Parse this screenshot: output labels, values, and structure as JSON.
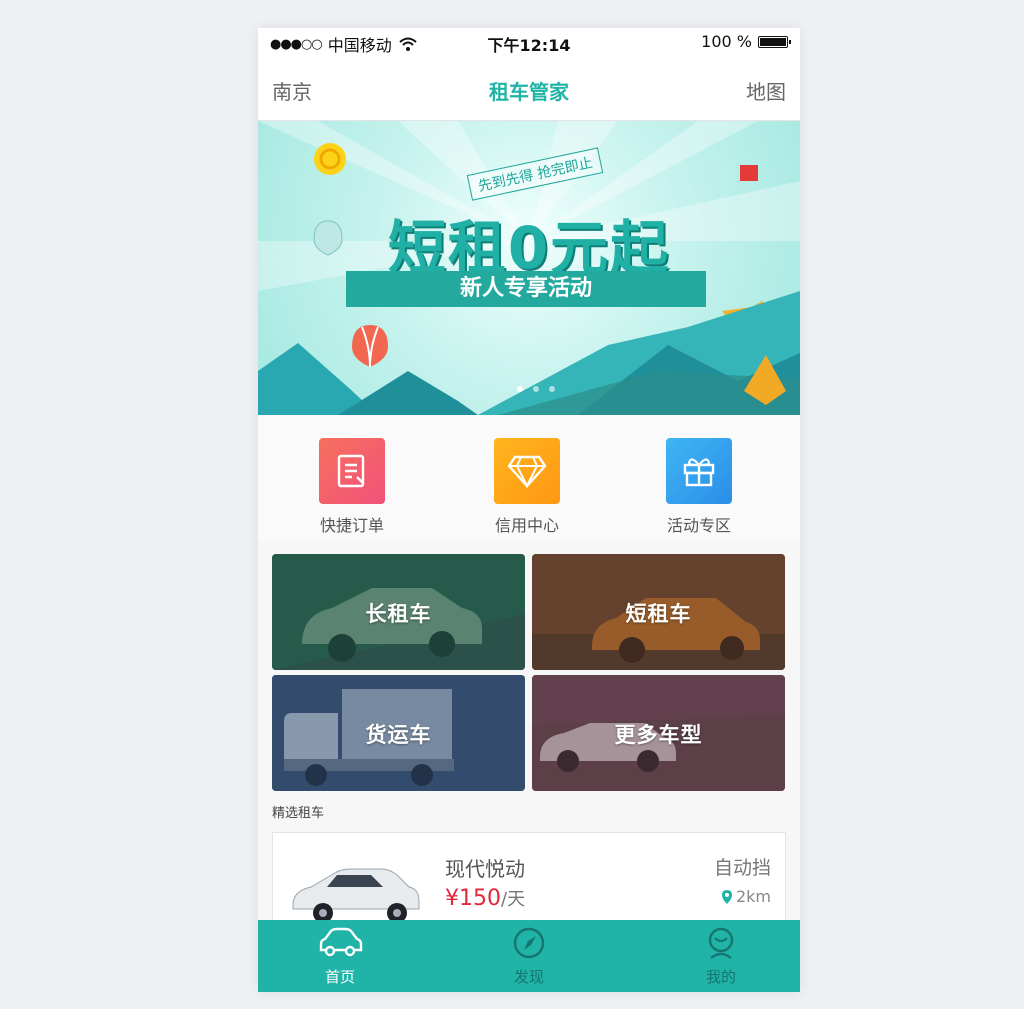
{
  "status_bar": {
    "signal": "●●●○○",
    "carrier": "中国移动",
    "time": "下午12:14",
    "battery": "100 %"
  },
  "nav": {
    "left": "南京",
    "title": "租车管家",
    "right": "地图"
  },
  "banner": {
    "tag": "先到先得 抢完即止",
    "headline": "短租0元起",
    "ribbon": "新人专享活动"
  },
  "quick_links": [
    {
      "label": "快捷订单",
      "icon": "order-icon",
      "color": "#f45d6b"
    },
    {
      "label": "信用中心",
      "icon": "diamond-icon",
      "color": "#ffa616"
    },
    {
      "label": "活动专区",
      "icon": "gift-icon",
      "color": "#31a8ee"
    }
  ],
  "categories": [
    {
      "label": "长租车"
    },
    {
      "label": "短租车"
    },
    {
      "label": "货运车"
    },
    {
      "label": "更多车型"
    }
  ],
  "section_title": "精选租车",
  "featured": {
    "name": "现代悦动",
    "price": "¥150",
    "unit": "/天",
    "transmission": "自动挡",
    "distance": "2km"
  },
  "tabbar": [
    {
      "label": "首页",
      "icon": "car-icon",
      "active": true
    },
    {
      "label": "发现",
      "icon": "compass-icon",
      "active": false
    },
    {
      "label": "我的",
      "icon": "profile-icon",
      "active": false
    }
  ],
  "colors": {
    "accent": "#20b3a7",
    "price": "#e0293a"
  }
}
